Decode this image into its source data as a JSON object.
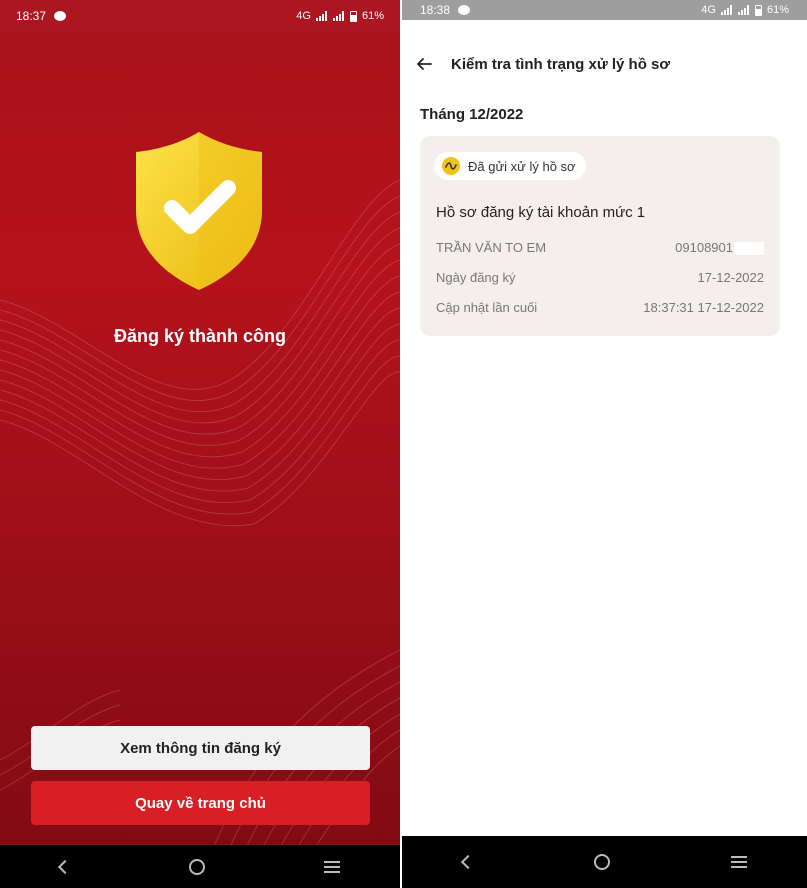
{
  "left_screen": {
    "status": {
      "time": "18:37",
      "network": "4G",
      "battery": "61%"
    },
    "success_text": "Đăng ký thành công",
    "view_button": "Xem thông tin đăng ký",
    "home_button": "Quay về trang chủ",
    "colors": {
      "background": "#a8111a",
      "primary_button": "#d71f25",
      "shield": "#f5cf1f"
    }
  },
  "right_screen": {
    "status": {
      "time": "18:38",
      "network": "4G",
      "battery": "61%"
    },
    "title": "Kiểm tra tình trạng xử lý hồ sơ",
    "month": "Tháng 12/2022",
    "card": {
      "status_badge": "Đã gửi xử lý hồ sơ",
      "title": "Hồ sơ đăng ký tài khoản mức 1",
      "name": "TRẦN VĂN TO EM",
      "phone": "09108901",
      "reg_label": "Ngày đăng ký",
      "reg_date": "17-12-2022",
      "update_label": "Cập nhật lần cuối",
      "update_value": "18:37:31 17-12-2022"
    }
  },
  "icons": [
    "chat-icon",
    "signal-icon",
    "battery-icon",
    "shield-check-icon",
    "back-arrow-icon",
    "nav-back-icon",
    "nav-home-icon",
    "nav-menu-icon",
    "wave-icon"
  ]
}
